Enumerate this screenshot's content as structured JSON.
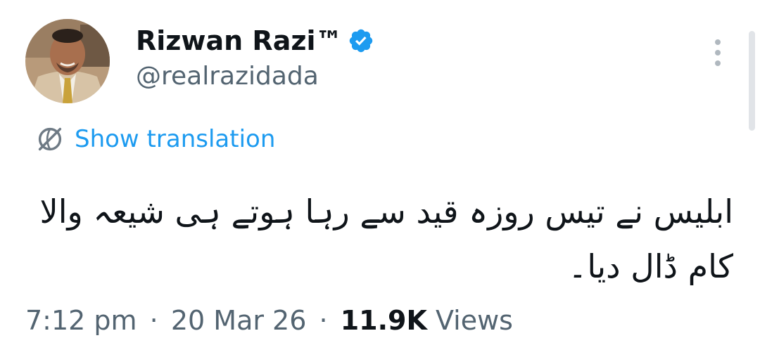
{
  "author": {
    "display_name": "Rizwan Razi™",
    "handle": "@realrazidada",
    "verified": true
  },
  "icons": {
    "verified": "verified-badge-icon",
    "more": "more-options-icon",
    "translate": "translate-globe-icon"
  },
  "colors": {
    "accent": "#1d9bf0",
    "secondary_text": "#536471",
    "primary_text": "#0f1419"
  },
  "translation": {
    "label": "Show translation"
  },
  "tweet": {
    "text": "ابلیس نے تیس روزہ قید سے رہا ہوتے ہی شیعہ والا کام ڈال دیا۔"
  },
  "meta": {
    "time": "7:12 pm",
    "sep1": "·",
    "date": "20 Mar 26",
    "sep2": "·",
    "views_count": "11.9K",
    "views_label": "Views"
  }
}
